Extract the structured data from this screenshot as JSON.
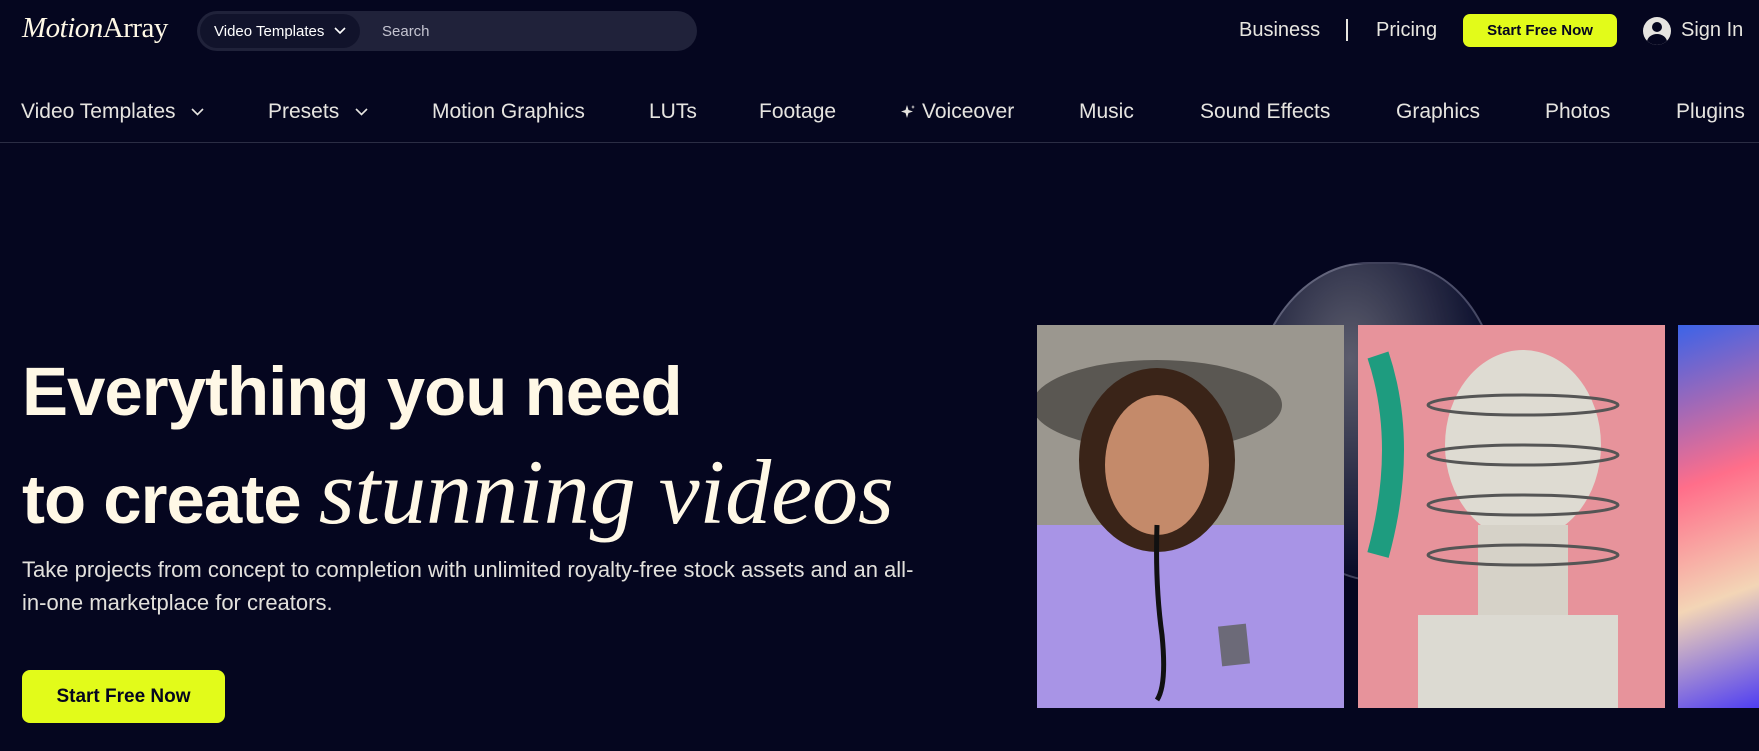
{
  "brand": {
    "logo_part1": "Motion",
    "logo_part2": "Array"
  },
  "search": {
    "category": "Video Templates",
    "placeholder": "Search"
  },
  "topnav": {
    "business": "Business",
    "pricing": "Pricing",
    "cta": "Start Free Now",
    "signin": "Sign In"
  },
  "nav": {
    "items": [
      {
        "label": "Video Templates",
        "dropdown": true
      },
      {
        "label": "Presets",
        "dropdown": true
      },
      {
        "label": "Motion Graphics"
      },
      {
        "label": "LUTs"
      },
      {
        "label": "Footage"
      },
      {
        "label": "Voiceover",
        "icon": "sparkle-icon"
      },
      {
        "label": "Music"
      },
      {
        "label": "Sound Effects"
      },
      {
        "label": "Graphics"
      },
      {
        "label": "Photos"
      },
      {
        "label": "Plugins"
      }
    ]
  },
  "hero": {
    "headline_line1": "Everything you need",
    "headline_line2_plain": "to create ",
    "headline_line2_accent": "stunning videos",
    "subtitle": "Take projects from concept to completion with unlimited royalty-free stock assets and an all-in-one marketplace for creators.",
    "cta": "Start Free Now"
  },
  "colors": {
    "background": "#05061f",
    "accent": "#e2fb1a",
    "text": "#fff8e6"
  }
}
